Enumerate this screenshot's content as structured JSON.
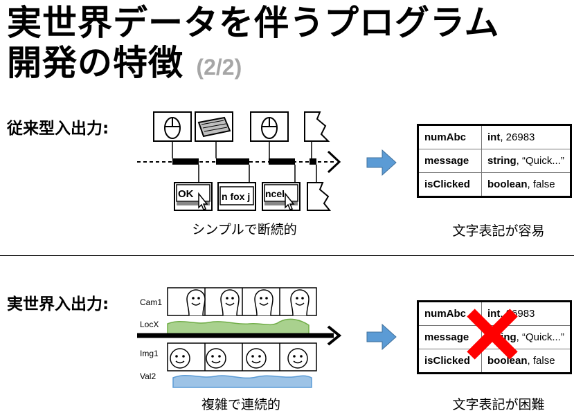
{
  "title": {
    "line1": "実世界データを伴うプログラム",
    "line2": "開発の特徴",
    "page": "(2/2)"
  },
  "traditional": {
    "label": "従来型入出力:",
    "screens": [
      "OK",
      "n fox j",
      "ncel"
    ],
    "caption": "シンプルで断続的",
    "record_caption": "文字表記が容易"
  },
  "realworld": {
    "label": "実世界入出力:",
    "tracks": [
      "Cam1",
      "LocX",
      "Img1",
      "Val2"
    ],
    "caption": "複雑で連続的",
    "record_caption": "文字表記が困難"
  },
  "record": [
    {
      "key": "numAbc",
      "type": "int",
      "value": ", 26983"
    },
    {
      "key": "message",
      "type": "string",
      "value": ", “Quick...”"
    },
    {
      "key": "isClicked",
      "type": "boolean",
      "value": ", false"
    }
  ],
  "colors": {
    "arrow": "#5b9bd5",
    "locx_fill": "#a9d18e",
    "val2_fill": "#9dc3e6",
    "cross": "#ff0000",
    "page_number": "#a6a6a6"
  }
}
